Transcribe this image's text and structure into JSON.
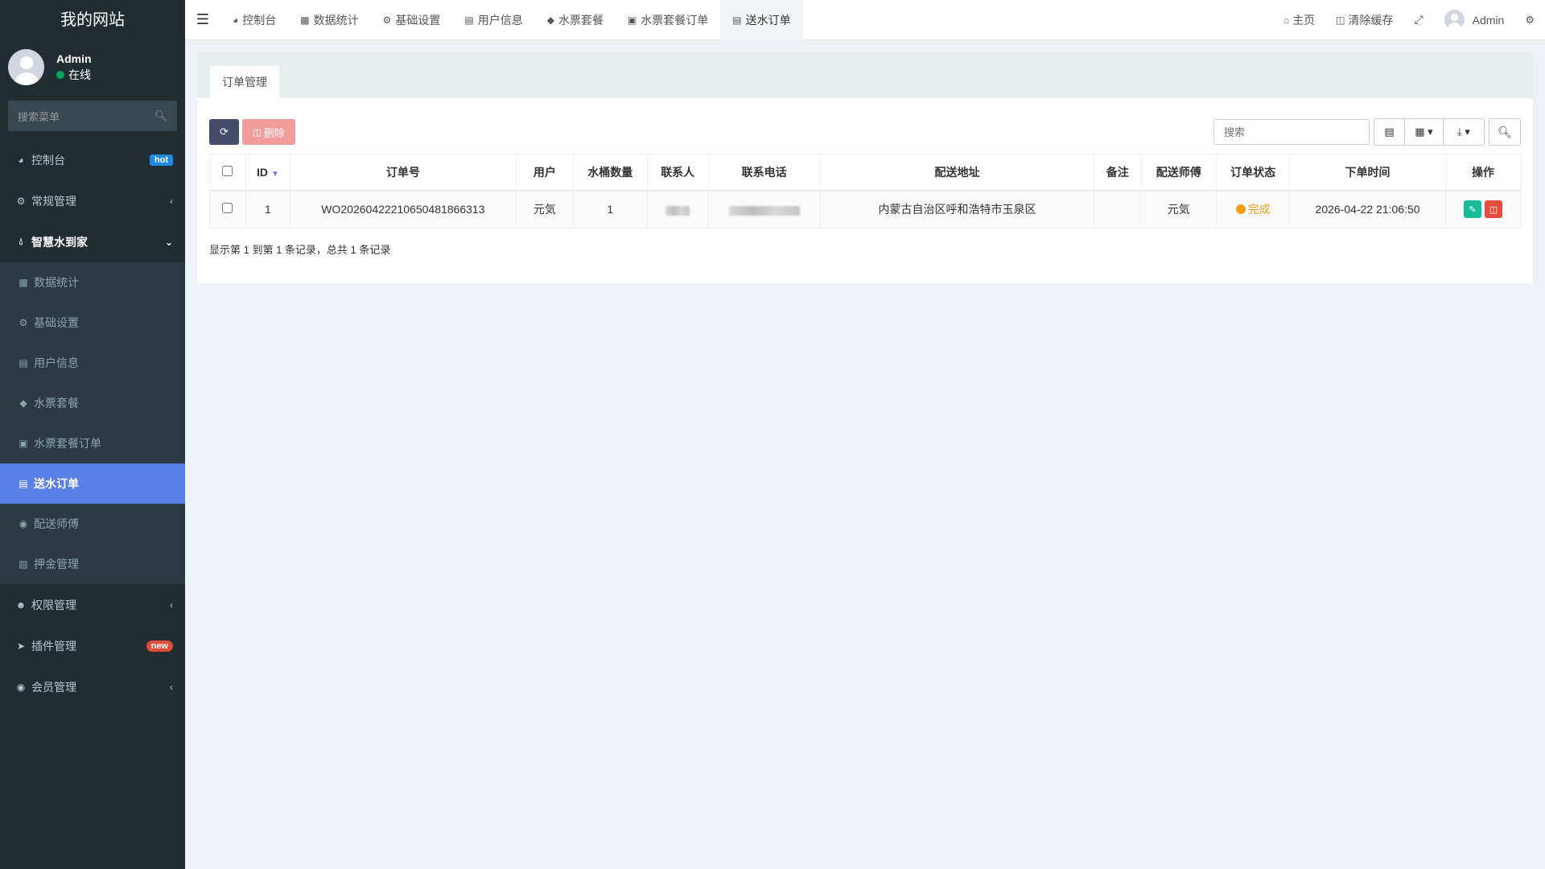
{
  "site": {
    "title": "我的网站"
  },
  "user": {
    "name": "Admin",
    "status": "在线"
  },
  "sidebar": {
    "search_placeholder": "搜索菜单",
    "items": [
      {
        "label": "控制台",
        "icon": "dashboard-icon",
        "badge": "hot"
      },
      {
        "label": "常规管理",
        "icon": "cogs-icon"
      },
      {
        "label": "智慧水到家",
        "icon": "tint-icon"
      },
      {
        "label": "权限管理",
        "icon": "group-icon"
      },
      {
        "label": "插件管理",
        "icon": "rocket-icon",
        "badge": "new"
      },
      {
        "label": "会员管理",
        "icon": "user-circle-icon"
      }
    ],
    "submenu": [
      {
        "label": "数据统计",
        "icon": "bar-chart-icon"
      },
      {
        "label": "基础设置",
        "icon": "gear-icon"
      },
      {
        "label": "用户信息",
        "icon": "credit-card-icon"
      },
      {
        "label": "水票套餐",
        "icon": "tag-icon"
      },
      {
        "label": "水票套餐订单",
        "icon": "cart-icon"
      },
      {
        "label": "送水订单",
        "icon": "list-icon"
      },
      {
        "label": "配送师傅",
        "icon": "user-icon"
      },
      {
        "label": "押金管理",
        "icon": "money-icon"
      }
    ]
  },
  "topnav": {
    "tabs": [
      {
        "label": "控制台",
        "icon": "dashboard-icon"
      },
      {
        "label": "数据统计",
        "icon": "bar-chart-icon"
      },
      {
        "label": "基础设置",
        "icon": "gear-icon"
      },
      {
        "label": "用户信息",
        "icon": "credit-card-icon"
      },
      {
        "label": "水票套餐",
        "icon": "tag-icon"
      },
      {
        "label": "水票套餐订单",
        "icon": "cart-icon"
      },
      {
        "label": "送水订单",
        "icon": "list-icon"
      }
    ],
    "home": "主页",
    "clear_cache": "清除缓存",
    "user": "Admin"
  },
  "panel": {
    "tab": "订单管理",
    "delete_label": "删除",
    "search_placeholder": "搜索",
    "columns": [
      "ID",
      "订单号",
      "用户",
      "水桶数量",
      "联系人",
      "联系电话",
      "配送地址",
      "备注",
      "配送师傅",
      "订单状态",
      "下单时间",
      "操作"
    ],
    "rows": [
      {
        "id": "1",
        "order_no": "WO20260422210650481866313",
        "user": "元気",
        "bucket_count": "1",
        "contact": "",
        "phone": "",
        "address": "内蒙古自治区呼和浩特市玉泉区",
        "remark": "",
        "courier": "元気",
        "status": "完成",
        "created_at": "2026-04-22 21:06:50"
      }
    ],
    "summary": "显示第 1 到第 1 条记录，总共 1 条记录"
  },
  "colors": {
    "sidebar_bg": "#222d32",
    "active_item": "#5a7fe6",
    "status_done": "#f39c12",
    "edit_btn": "#18bc9c",
    "delete_btn": "#e74c3c"
  }
}
